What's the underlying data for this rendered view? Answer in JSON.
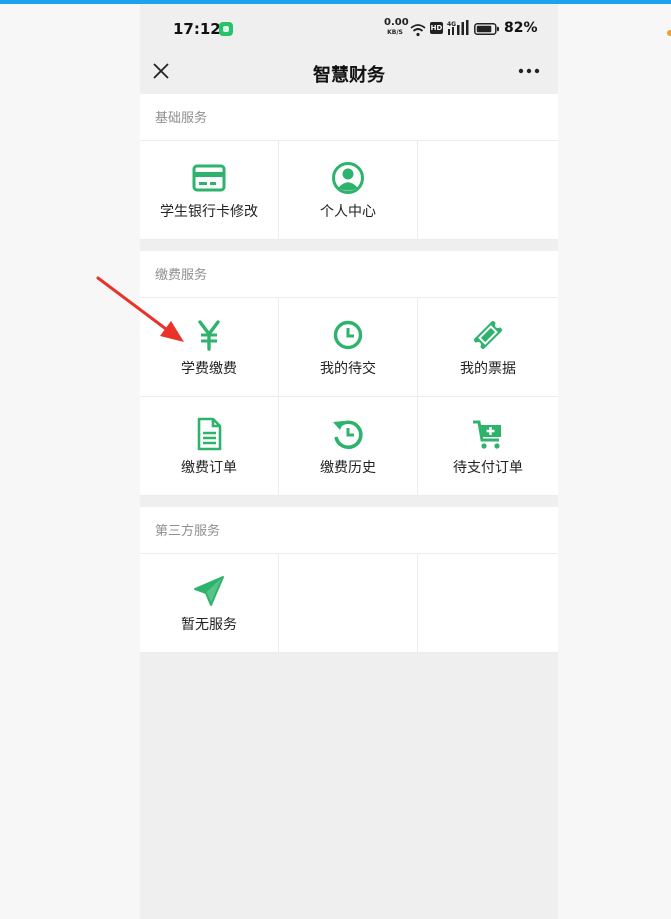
{
  "status_bar": {
    "time": "17:12",
    "net_speed_value": "0.00",
    "net_speed_unit": "KB/S",
    "hd_label": "HD",
    "network_type": "4G",
    "battery": "82%"
  },
  "nav": {
    "title": "智慧财务"
  },
  "sections": [
    {
      "title": "基础服务",
      "items": [
        {
          "label": "学生银行卡修改",
          "icon": "bank-card-icon"
        },
        {
          "label": "个人中心",
          "icon": "user-icon"
        }
      ]
    },
    {
      "title": "缴费服务",
      "items": [
        {
          "label": "学费缴费",
          "icon": "yen-icon"
        },
        {
          "label": "我的待交",
          "icon": "clock-icon"
        },
        {
          "label": "我的票据",
          "icon": "ticket-icon"
        },
        {
          "label": "缴费订单",
          "icon": "document-icon"
        },
        {
          "label": "缴费历史",
          "icon": "history-icon"
        },
        {
          "label": "待支付订单",
          "icon": "cart-icon"
        }
      ]
    },
    {
      "title": "第三方服务",
      "items": [
        {
          "label": "暂无服务",
          "icon": "paper-plane-icon"
        }
      ]
    }
  ],
  "colors": {
    "accent": "#2db36b",
    "annotation_arrow": "#e8322a",
    "top_line": "#1aa3ea"
  }
}
